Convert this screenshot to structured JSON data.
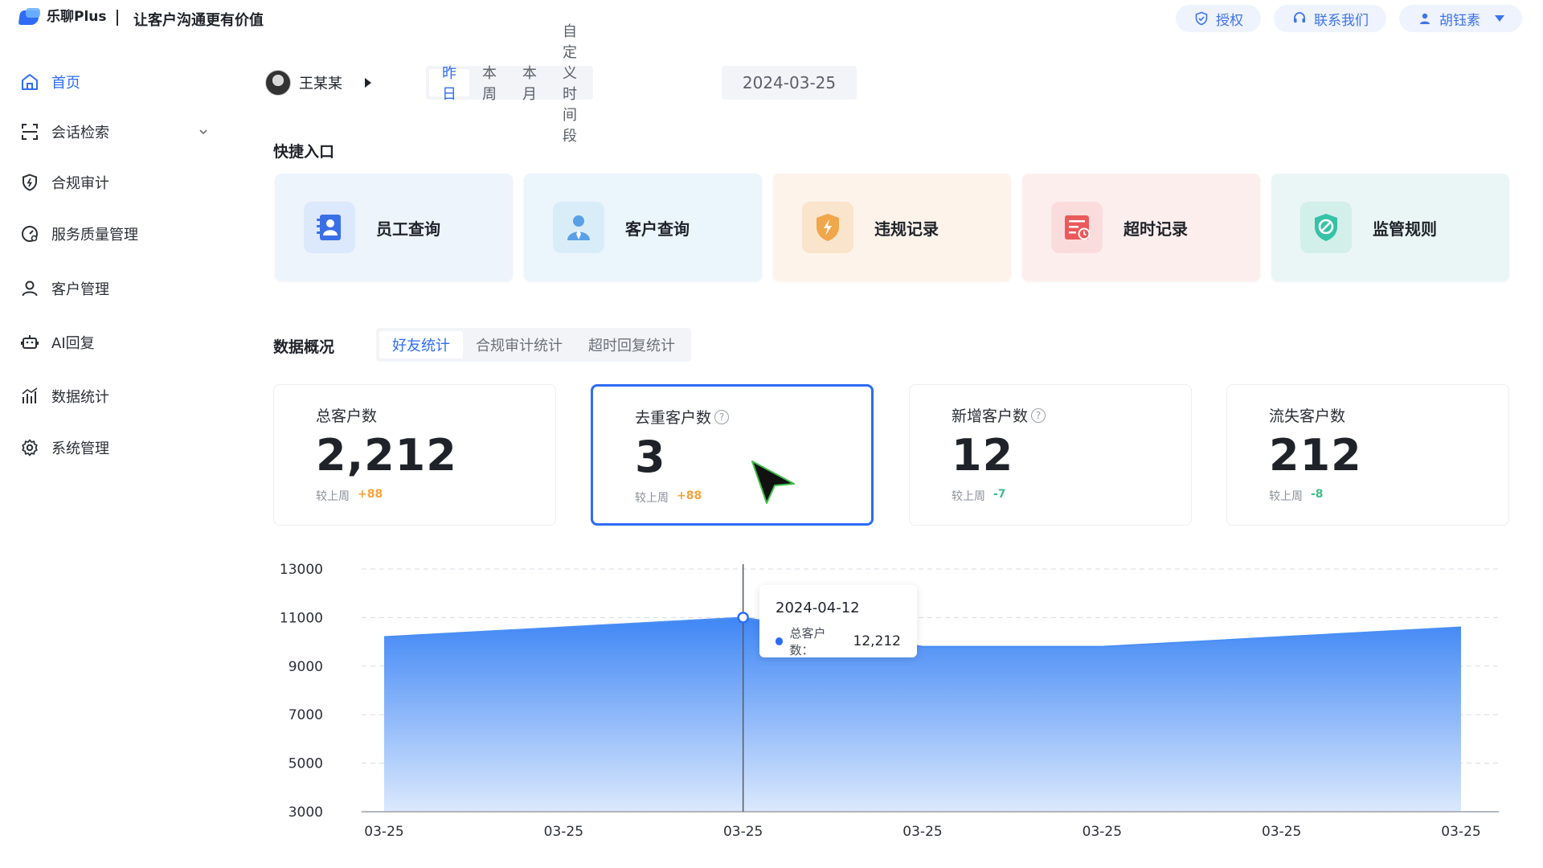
{
  "header": {
    "logo_name": "乐聊Plus",
    "slogan": "让客户沟通更有价值",
    "actions": [
      {
        "label": "授权",
        "icon": "shield-check-icon"
      },
      {
        "label": "联系我们",
        "icon": "headset-icon"
      },
      {
        "label": "胡钰素",
        "icon": "user-icon"
      }
    ]
  },
  "sidebar": {
    "items": [
      {
        "label": "首页",
        "icon": "home-icon",
        "active": true
      },
      {
        "label": "会话检索",
        "icon": "scan-icon",
        "expandable": true
      },
      {
        "label": "合规审计",
        "icon": "shield-bolt-icon"
      },
      {
        "label": "服务质量管理",
        "icon": "gauge-icon"
      },
      {
        "label": "客户管理",
        "icon": "person-icon"
      },
      {
        "label": "AI回复",
        "icon": "robot-icon"
      },
      {
        "label": "数据统计",
        "icon": "bar-chart-icon"
      },
      {
        "label": "系统管理",
        "icon": "gear-icon"
      }
    ]
  },
  "filters": {
    "user_name": "王某某",
    "periods": [
      "昨日",
      "本周",
      "本月",
      "自定义时间段"
    ],
    "active_period": "昨日",
    "date": "2024-03-25"
  },
  "quick_entry": {
    "title": "快捷入口",
    "cards": [
      {
        "label": "员工查询",
        "icon": "employee-book-icon",
        "bg": "#eef4fc",
        "icon_color": "#3a6fe6"
      },
      {
        "label": "客户查询",
        "icon": "customer-icon",
        "bg": "#ebf5fc",
        "icon_color": "#5aa0e6"
      },
      {
        "label": "违规记录",
        "icon": "shield-warning-icon",
        "bg": "#fdf3ea",
        "icon_color": "#f0a64a"
      },
      {
        "label": "超时记录",
        "icon": "timeout-record-icon",
        "bg": "#fdeeee",
        "icon_color": "#ea5a5a"
      },
      {
        "label": "监管规则",
        "icon": "rule-shield-icon",
        "bg": "#eaf6f6",
        "icon_color": "#35c2a8"
      }
    ]
  },
  "overview": {
    "title": "数据概况",
    "tabs": [
      "好友统计",
      "合规审计统计",
      "超时回复统计"
    ],
    "active_tab": "好友统计",
    "compare_label": "较上周",
    "stats": [
      {
        "label": "总客户数",
        "value": "2,212",
        "delta": "+88",
        "trend": "up",
        "help": false
      },
      {
        "label": "去重客户数",
        "value": "3",
        "delta": "+88",
        "trend": "up",
        "help": true,
        "selected": true
      },
      {
        "label": "新增客户数",
        "value": "12",
        "delta": "-7",
        "trend": "down",
        "help": true
      },
      {
        "label": "流失客户数",
        "value": "212",
        "delta": "-8",
        "trend": "down",
        "help": false
      }
    ]
  },
  "chart_data": {
    "type": "area",
    "x": [
      "03-25",
      "03-25",
      "03-25",
      "03-25",
      "03-25",
      "03-25",
      "03-25"
    ],
    "series": [
      {
        "name": "总客户数",
        "values": [
          10200,
          10600,
          11000,
          9800,
          9800,
          10200,
          10600
        ],
        "color": "#4a8ef5"
      }
    ],
    "y_ticks": [
      3000,
      5000,
      7000,
      9000,
      11000,
      13000
    ],
    "ylim": [
      3000,
      13000
    ],
    "grid": true,
    "tooltip": {
      "date": "2024-04-12",
      "series_label": "总客户数：",
      "value": "12,212",
      "index": 2
    }
  }
}
